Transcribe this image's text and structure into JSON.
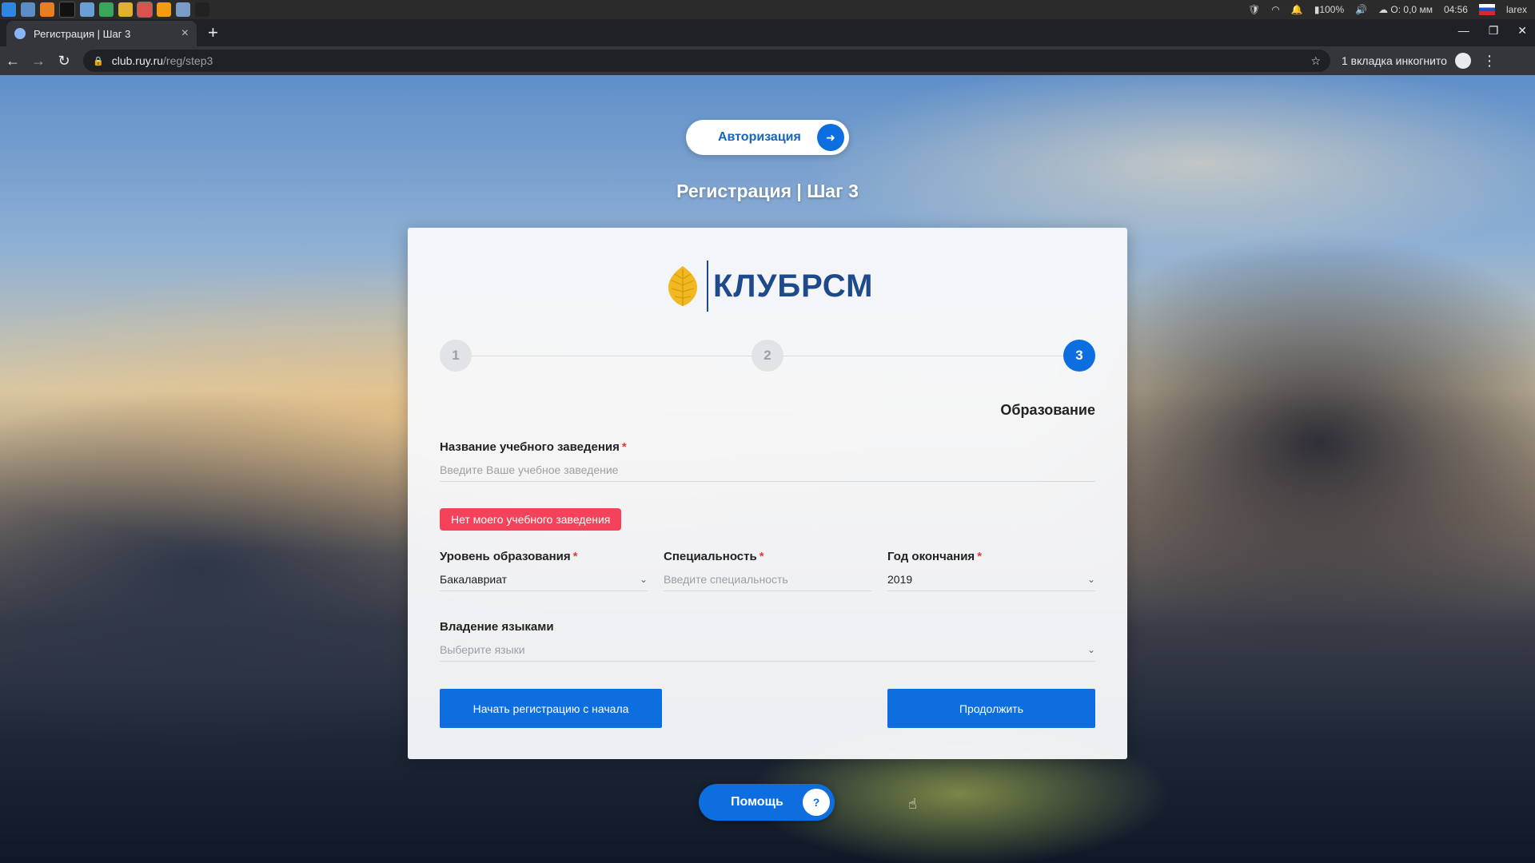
{
  "os_bar": {
    "apps": [
      "app-launcher-icon",
      "file-manager-icon",
      "package-icon",
      "terminal-icon",
      "folder-icon",
      "chrome-icon",
      "chrome-icon",
      "chrome-active-icon",
      "sublime-icon",
      "folder-icon",
      "terminal-icon"
    ],
    "battery": "100%",
    "network": "O: 0,0 мм",
    "time": "04:56",
    "user": "larex"
  },
  "browser": {
    "tab_title": "Регистрация | Шаг 3",
    "url_host": "club.ruy.ru",
    "url_path": "/reg/step3",
    "incognito_label": "1 вкладка инкогнито"
  },
  "page": {
    "auth_button": "Авторизация",
    "title": "Регистрация | Шаг 3",
    "logo_text": "КЛУБРСМ",
    "steps": [
      "1",
      "2",
      "3"
    ],
    "active_step": "3",
    "step_caption": "Образование",
    "institution": {
      "label": "Название учебного заведения",
      "required_mark": "*",
      "placeholder": "Введите Ваше учебное заведение"
    },
    "no_institution_button": "Нет моего учебного заведения",
    "education_level": {
      "label": "Уровень образования",
      "required_mark": "*",
      "value": "Бакалавриат"
    },
    "specialty": {
      "label": "Специальность",
      "required_mark": "*",
      "placeholder": "Введите специальность"
    },
    "graduation_year": {
      "label": "Год окончания",
      "required_mark": "*",
      "value": "2019"
    },
    "languages": {
      "label": "Владение языками",
      "placeholder": "Выберите языки"
    },
    "restart_button": "Начать регистрацию с начала",
    "continue_button": "Продолжить",
    "help_button": "Помощь"
  },
  "colors": {
    "accent": "#0d6ee0",
    "danger": "#f4425a",
    "logo_blue": "#1e4a8c",
    "logo_gold": "#f2b822"
  }
}
